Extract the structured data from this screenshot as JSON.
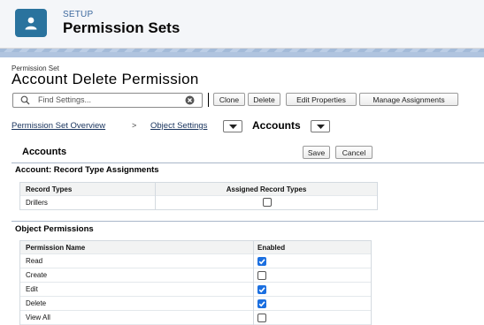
{
  "header": {
    "setup_label": "SETUP",
    "title": "Permission Sets"
  },
  "page": {
    "subtitle": "Permission Set",
    "title": "Account Delete Permission"
  },
  "search": {
    "placeholder": "Find Settings..."
  },
  "toolbar": {
    "clone": "Clone",
    "delete": "Delete",
    "edit_properties": "Edit Properties",
    "manage_assignments": "Manage Assignments"
  },
  "breadcrumb": {
    "overview": "Permission Set Overview",
    "separator": ">",
    "object_settings": "Object Settings",
    "current": "Accounts"
  },
  "section": {
    "title": "Accounts",
    "save": "Save",
    "cancel": "Cancel"
  },
  "record_types": {
    "heading": "Account: Record Type Assignments",
    "columns": [
      "Record Types",
      "Assigned Record Types"
    ],
    "rows": [
      {
        "name": "Drillers",
        "assigned": false
      }
    ]
  },
  "object_permissions": {
    "heading": "Object Permissions",
    "columns": [
      "Permission Name",
      "Enabled"
    ],
    "rows": [
      {
        "name": "Read",
        "enabled": true
      },
      {
        "name": "Create",
        "enabled": false
      },
      {
        "name": "Edit",
        "enabled": true
      },
      {
        "name": "Delete",
        "enabled": true
      },
      {
        "name": "View All",
        "enabled": false
      }
    ]
  },
  "colors": {
    "accent": "#2a739e",
    "checkbox_checked": "#1b6fe0"
  }
}
